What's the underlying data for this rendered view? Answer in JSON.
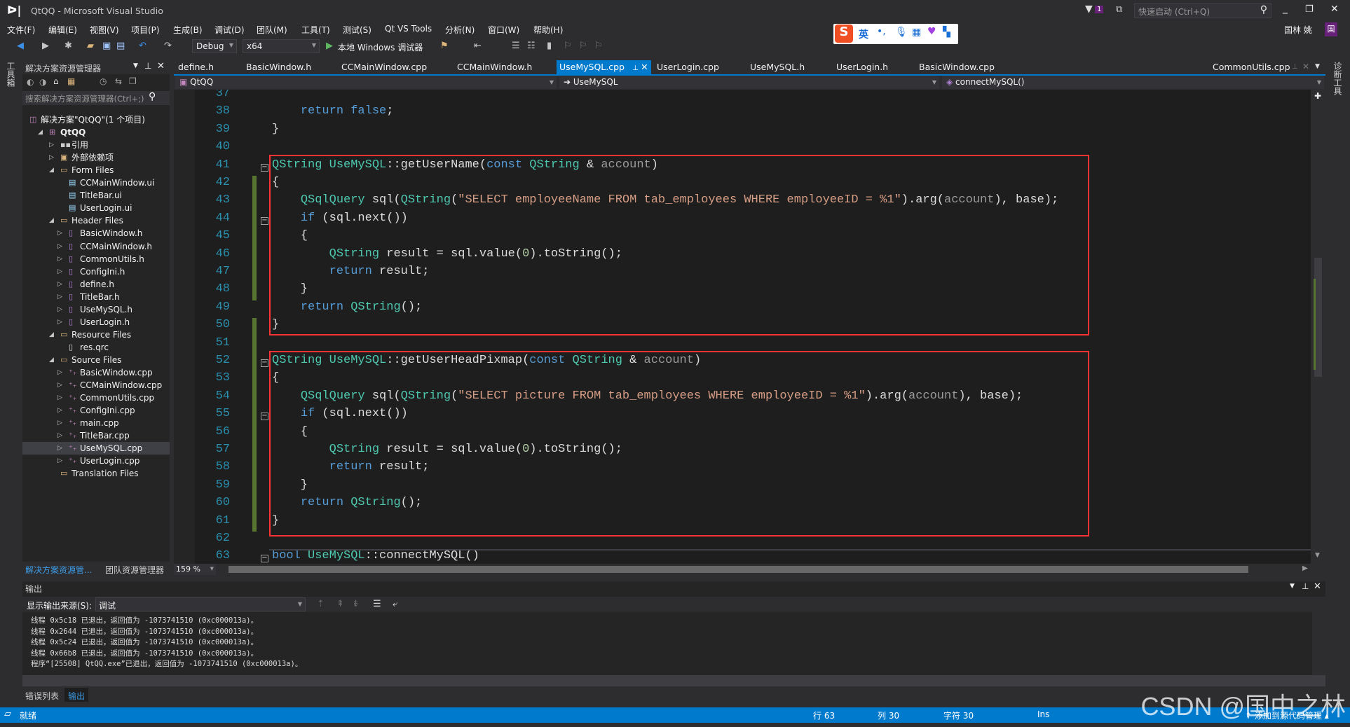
{
  "window": {
    "title": "QtQQ - Microsoft Visual Studio",
    "notif_count": "1",
    "quick_launch_placeholder": "快速启动 (Ctrl+Q)",
    "user": "国林 姚",
    "avatar": "国"
  },
  "menu": [
    "文件(F)",
    "编辑(E)",
    "视图(V)",
    "项目(P)",
    "生成(B)",
    "调试(D)",
    "团队(M)",
    "工具(T)",
    "测试(S)",
    "Qt VS Tools",
    "分析(N)",
    "窗口(W)",
    "帮助(H)"
  ],
  "toolbar": {
    "config": "Debug",
    "platform": "x64",
    "debugger": "本地 Windows 调试器"
  },
  "ime": {
    "mode": "英"
  },
  "left_strip": "工具箱",
  "right_strip": "诊断工具",
  "solution_explorer": {
    "title": "解决方案资源管理器",
    "search_placeholder": "搜索解决方案资源管理器(Ctrl+;)",
    "items": [
      {
        "label": "解决方案\"QtQQ\"(1 个项目)",
        "level": 0,
        "icon": "solution-icon",
        "exp": ""
      },
      {
        "label": "QtQQ",
        "level": 1,
        "icon": "project-icon",
        "exp": "open",
        "bold": true
      },
      {
        "label": "引用",
        "level": 2,
        "icon": "references-icon",
        "exp": "closed"
      },
      {
        "label": "外部依赖项",
        "level": 2,
        "icon": "external-deps-icon",
        "exp": "closed"
      },
      {
        "label": "Form Files",
        "level": 2,
        "icon": "folder-icon",
        "exp": "open"
      },
      {
        "label": "CCMainWindow.ui",
        "level": 3,
        "icon": "ui-file-icon",
        "exp": ""
      },
      {
        "label": "TitleBar.ui",
        "level": 3,
        "icon": "ui-file-icon",
        "exp": ""
      },
      {
        "label": "UserLogin.ui",
        "level": 3,
        "icon": "ui-file-icon",
        "exp": ""
      },
      {
        "label": "Header Files",
        "level": 2,
        "icon": "folder-icon",
        "exp": "open"
      },
      {
        "label": "BasicWindow.h",
        "level": 3,
        "icon": "header-file-icon",
        "exp": "closed"
      },
      {
        "label": "CCMainWindow.h",
        "level": 3,
        "icon": "header-file-icon",
        "exp": "closed"
      },
      {
        "label": "CommonUtils.h",
        "level": 3,
        "icon": "header-file-icon",
        "exp": "closed"
      },
      {
        "label": "ConfigIni.h",
        "level": 3,
        "icon": "header-file-icon",
        "exp": "closed"
      },
      {
        "label": "define.h",
        "level": 3,
        "icon": "header-file-icon",
        "exp": "closed"
      },
      {
        "label": "TitleBar.h",
        "level": 3,
        "icon": "header-file-icon",
        "exp": "closed"
      },
      {
        "label": "UseMySQL.h",
        "level": 3,
        "icon": "header-file-icon",
        "exp": "closed"
      },
      {
        "label": "UserLogin.h",
        "level": 3,
        "icon": "header-file-icon",
        "exp": "closed"
      },
      {
        "label": "Resource Files",
        "level": 2,
        "icon": "folder-icon",
        "exp": "open"
      },
      {
        "label": "res.qrc",
        "level": 3,
        "icon": "file-icon",
        "exp": ""
      },
      {
        "label": "Source Files",
        "level": 2,
        "icon": "folder-icon",
        "exp": "open"
      },
      {
        "label": "BasicWindow.cpp",
        "level": 3,
        "icon": "cpp-file-icon",
        "exp": "closed"
      },
      {
        "label": "CCMainWindow.cpp",
        "level": 3,
        "icon": "cpp-file-icon",
        "exp": "closed"
      },
      {
        "label": "CommonUtils.cpp",
        "level": 3,
        "icon": "cpp-file-icon",
        "exp": "closed"
      },
      {
        "label": "ConfigIni.cpp",
        "level": 3,
        "icon": "cpp-file-icon",
        "exp": "closed"
      },
      {
        "label": "main.cpp",
        "level": 3,
        "icon": "cpp-file-icon",
        "exp": "closed"
      },
      {
        "label": "TitleBar.cpp",
        "level": 3,
        "icon": "cpp-file-icon",
        "exp": "closed"
      },
      {
        "label": "UseMySQL.cpp",
        "level": 3,
        "icon": "cpp-file-icon",
        "exp": "closed",
        "selected": true
      },
      {
        "label": "UserLogin.cpp",
        "level": 3,
        "icon": "cpp-file-icon",
        "exp": "closed"
      },
      {
        "label": "Translation Files",
        "level": 2,
        "icon": "folder-icon",
        "exp": ""
      }
    ],
    "bottom_tabs": [
      "解决方案资源管...",
      "团队资源管理器"
    ]
  },
  "tabs": [
    {
      "label": "define.h"
    },
    {
      "label": "BasicWindow.h"
    },
    {
      "label": "CCMainWindow.cpp"
    },
    {
      "label": "CCMainWindow.h"
    },
    {
      "label": "UseMySQL.cpp",
      "active": true
    },
    {
      "label": "UserLogin.cpp"
    },
    {
      "label": "UseMySQL.h"
    },
    {
      "label": "UserLogin.h"
    },
    {
      "label": "BasicWindow.cpp"
    },
    {
      "label": "CommonUtils.cpp"
    }
  ],
  "navbar": {
    "project": "QtQQ",
    "class": "UseMySQL",
    "member": "connectMySQL()"
  },
  "editor": {
    "zoom": "159 %",
    "first_line": 37,
    "lines": [
      [],
      [
        [
          "    ",
          "d"
        ],
        [
          "return false",
          "k"
        ],
        [
          ";",
          "d"
        ]
      ],
      [
        [
          "}",
          "d"
        ]
      ],
      [],
      [
        [
          "QString ",
          "t"
        ],
        [
          "UseMySQL",
          "t"
        ],
        [
          "::getUserName(",
          "d"
        ],
        [
          "const ",
          "k"
        ],
        [
          "QString ",
          "t"
        ],
        [
          "& ",
          "d"
        ],
        [
          "account",
          "p"
        ],
        [
          ")",
          "d"
        ]
      ],
      [
        [
          "{",
          "d"
        ]
      ],
      [
        [
          "    ",
          "d"
        ],
        [
          "QSqlQuery ",
          "t"
        ],
        [
          "sql(",
          "d"
        ],
        [
          "QString",
          "t"
        ],
        [
          "(",
          "d"
        ],
        [
          "\"SELECT employeeName FROM tab_employees WHERE employeeID = %1\"",
          "s"
        ],
        [
          ").arg(",
          "d"
        ],
        [
          "account",
          "p"
        ],
        [
          "), base);",
          "d"
        ]
      ],
      [
        [
          "    ",
          "d"
        ],
        [
          "if ",
          "k"
        ],
        [
          "(sql.next())",
          "d"
        ]
      ],
      [
        [
          "    {",
          "d"
        ]
      ],
      [
        [
          "        ",
          "d"
        ],
        [
          "QString ",
          "t"
        ],
        [
          "result = sql.value(",
          "d"
        ],
        [
          "0",
          "n"
        ],
        [
          ").toString();",
          "d"
        ]
      ],
      [
        [
          "        ",
          "d"
        ],
        [
          "return ",
          "k"
        ],
        [
          "result;",
          "d"
        ]
      ],
      [
        [
          "    }",
          "d"
        ]
      ],
      [
        [
          "    ",
          "d"
        ],
        [
          "return ",
          "k"
        ],
        [
          "QString",
          "t"
        ],
        [
          "();",
          "d"
        ]
      ],
      [
        [
          "}",
          "d"
        ]
      ],
      [],
      [
        [
          "QString ",
          "t"
        ],
        [
          "UseMySQL",
          "t"
        ],
        [
          "::getUserHeadPixmap(",
          "d"
        ],
        [
          "const ",
          "k"
        ],
        [
          "QString ",
          "t"
        ],
        [
          "& ",
          "d"
        ],
        [
          "account",
          "p"
        ],
        [
          ")",
          "d"
        ]
      ],
      [
        [
          "{",
          "d"
        ]
      ],
      [
        [
          "    ",
          "d"
        ],
        [
          "QSqlQuery ",
          "t"
        ],
        [
          "sql(",
          "d"
        ],
        [
          "QString",
          "t"
        ],
        [
          "(",
          "d"
        ],
        [
          "\"SELECT picture FROM tab_employees WHERE employeeID = %1\"",
          "s"
        ],
        [
          ").arg(",
          "d"
        ],
        [
          "account",
          "p"
        ],
        [
          "), base);",
          "d"
        ]
      ],
      [
        [
          "    ",
          "d"
        ],
        [
          "if ",
          "k"
        ],
        [
          "(sql.next())",
          "d"
        ]
      ],
      [
        [
          "    {",
          "d"
        ]
      ],
      [
        [
          "        ",
          "d"
        ],
        [
          "QString ",
          "t"
        ],
        [
          "result = sql.value(",
          "d"
        ],
        [
          "0",
          "n"
        ],
        [
          ").toString();",
          "d"
        ]
      ],
      [
        [
          "        ",
          "d"
        ],
        [
          "return ",
          "k"
        ],
        [
          "result;",
          "d"
        ]
      ],
      [
        [
          "    }",
          "d"
        ]
      ],
      [
        [
          "    ",
          "d"
        ],
        [
          "return ",
          "k"
        ],
        [
          "QString",
          "t"
        ],
        [
          "();",
          "d"
        ]
      ],
      [
        [
          "}",
          "d"
        ]
      ],
      [],
      [
        [
          "bool ",
          "k"
        ],
        [
          "UseMySQL",
          "t"
        ],
        [
          "::connectMySQL()",
          "d"
        ]
      ]
    ]
  },
  "output": {
    "title": "输出",
    "source_label": "显示输出来源(S):",
    "source_value": "调试",
    "lines": [
      "线程 0x5c18 已退出，返回值为 -1073741510 (0xc000013a)。",
      "线程 0x2644 已退出，返回值为 -1073741510 (0xc000013a)。",
      "线程 0x5c24 已退出，返回值为 -1073741510 (0xc000013a)。",
      "线程 0x66b8 已退出，返回值为 -1073741510 (0xc000013a)。",
      "程序“[25508] QtQQ.exe”已退出，返回值为 -1073741510 (0xc000013a)。"
    ]
  },
  "bottom_tabs": [
    "错误列表",
    "输出"
  ],
  "status": {
    "ready": "就绪",
    "line": "行 63",
    "col": "列 30",
    "char": "字符 30",
    "mode": "Ins",
    "source_control": "↑ 添加到源代码管理 ▴"
  },
  "watermark": "CSDN @国中之林",
  "colors": {
    "accent": "#007acc",
    "highlight_box": "#ff3333",
    "change_bar": "#577430"
  }
}
